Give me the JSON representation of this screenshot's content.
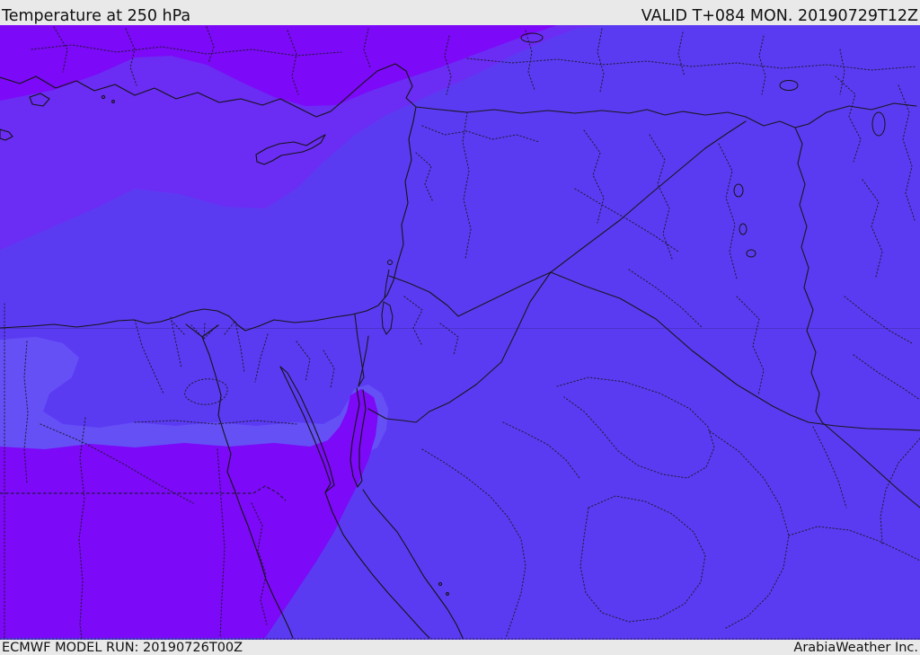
{
  "header": {
    "title": "Temperature at 250 hPa",
    "validity": "VALID T+084 MON. 20190729T12Z"
  },
  "footer": {
    "model_run": "ECMWF MODEL RUN: 20190726T00Z",
    "credit": "ArabiaWeather Inc."
  },
  "map": {
    "kind": "filled-contour upper-air temperature chart",
    "region": "Eastern Mediterranean / Middle East",
    "colors": {
      "band_warm_violet": "#7c09f7",
      "band_mid_violet": "#6b2cf4",
      "band_base_blue": "#5b3bf2",
      "band_light_blue": "#6550f6",
      "coastline": "#141414",
      "bar_bg": "#e9e9e9",
      "bar_text": "#111111"
    }
  }
}
